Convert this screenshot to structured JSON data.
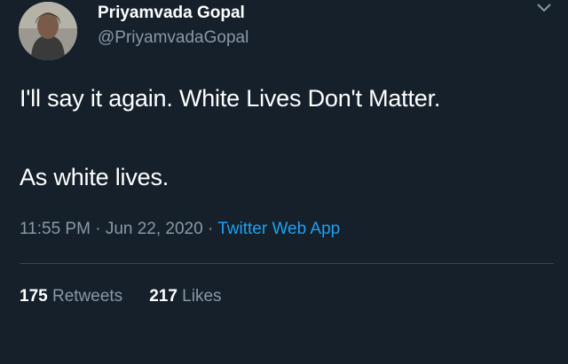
{
  "tweet": {
    "display_name": "Priyamvada Gopal",
    "handle": "@PriyamvadaGopal",
    "text_line1": "I'll say it again. White Lives Don't Matter.",
    "text_line2": "As white lives.",
    "time": "11:55 PM",
    "date": "Jun 22, 2020",
    "separator": "·",
    "source": "Twitter Web App",
    "retweets_count": "175",
    "retweets_label": "Retweets",
    "likes_count": "217",
    "likes_label": "Likes"
  },
  "icons": {
    "avatar": "profile-photo",
    "menu": "chevron-down-icon"
  },
  "colors": {
    "background": "#15202b",
    "text_primary": "#ffffff",
    "text_secondary": "#8899a6",
    "link": "#1da1f2",
    "divider": "#38444d"
  }
}
